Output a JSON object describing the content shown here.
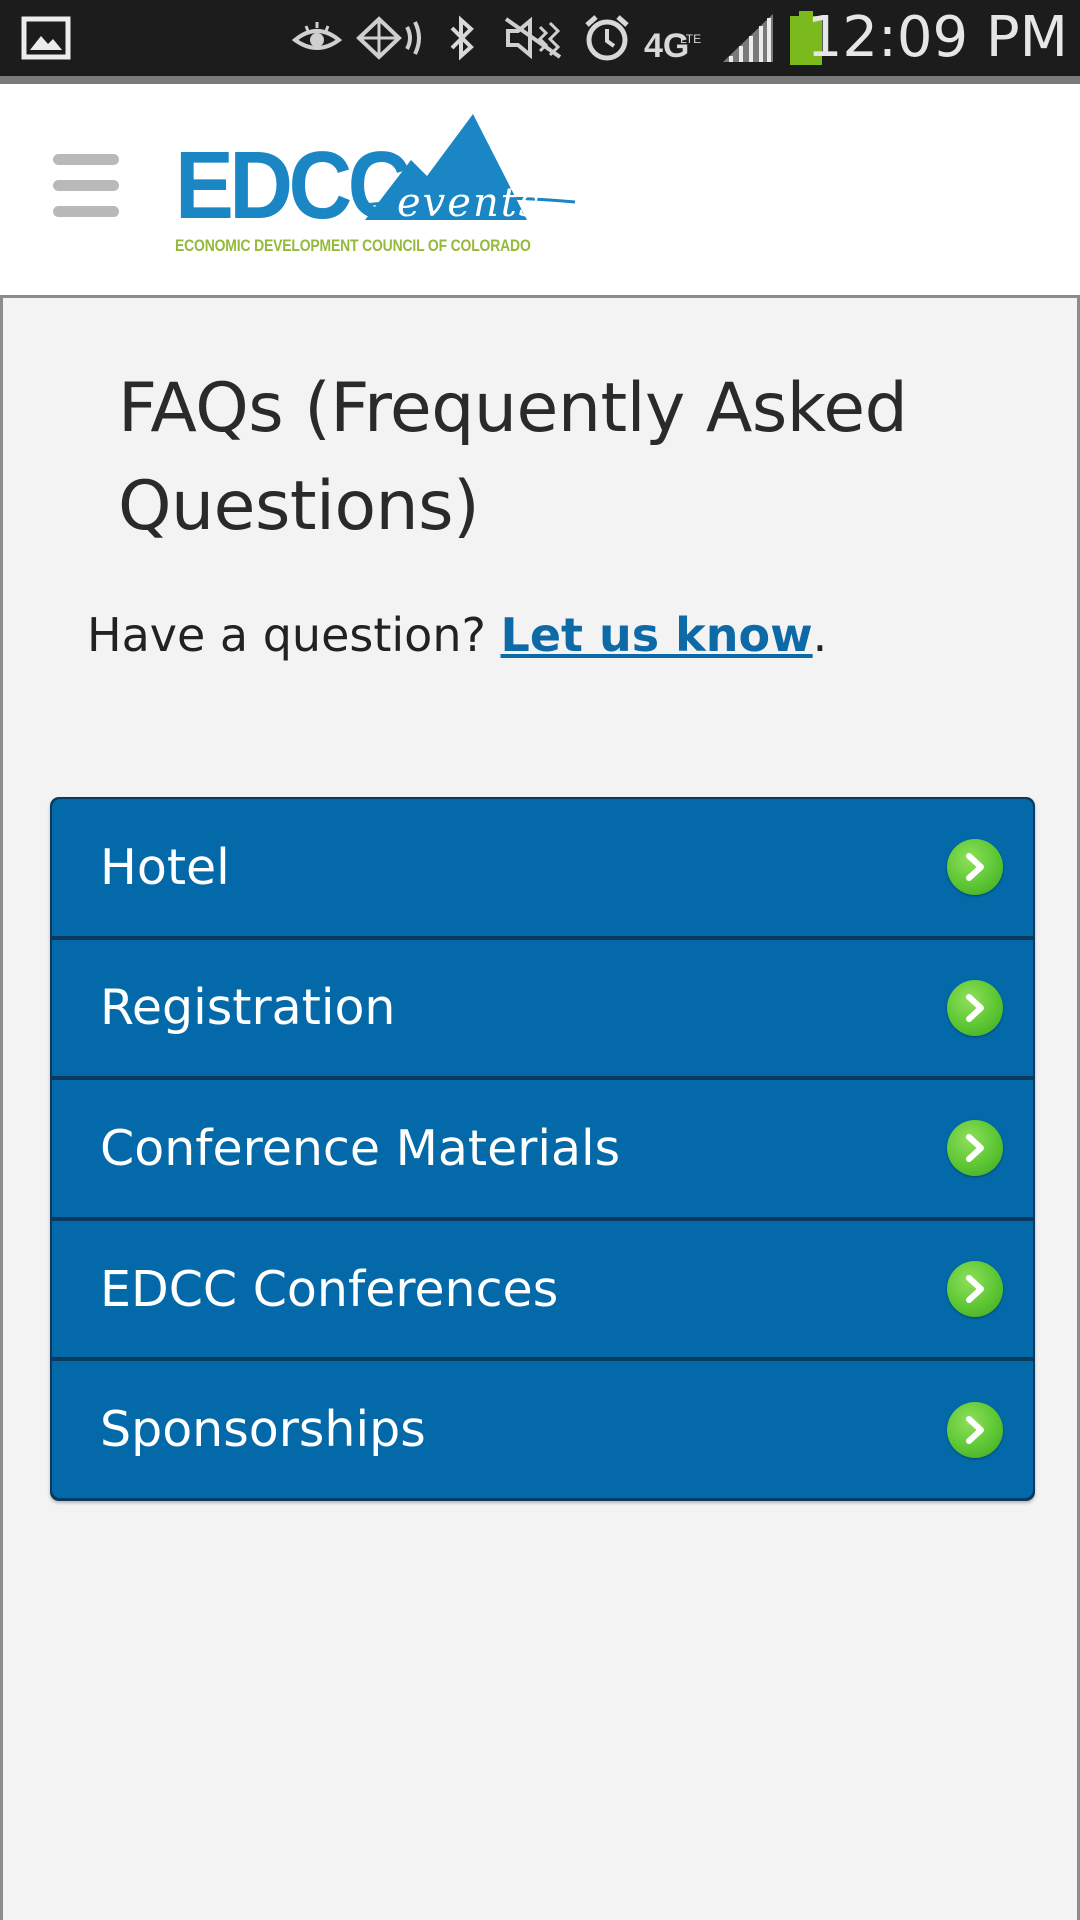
{
  "status_bar": {
    "time": "12:09 PM",
    "network_label": "4G",
    "network_sub": "LTE",
    "icons": [
      "gallery-icon",
      "eye-icon",
      "nfc-icon",
      "bluetooth-icon",
      "mute-icon",
      "alarm-icon",
      "4g-lte-icon",
      "signal-icon",
      "battery-icon"
    ],
    "battery_color": "#7cb91c"
  },
  "header": {
    "logo": {
      "main": "EDCC",
      "script": "events",
      "subtitle": "ECONOMIC DEVELOPMENT COUNCIL OF COLORADO"
    },
    "menu_icon": "hamburger-icon"
  },
  "main": {
    "title": "FAQs (Frequently Asked Questions)",
    "intro_text": "Have a question? ",
    "intro_link": "Let us know",
    "intro_end": "."
  },
  "faq": {
    "items": [
      {
        "label": "Hotel"
      },
      {
        "label": "Registration"
      },
      {
        "label": "Conference Materials"
      },
      {
        "label": "EDCC Conferences"
      },
      {
        "label": "Sponsorships"
      }
    ],
    "arrow_icon": "chevron-right-icon",
    "colors": {
      "item": "#0369a8",
      "arrow": "#5cc634",
      "link": "#0e6aa6"
    }
  }
}
